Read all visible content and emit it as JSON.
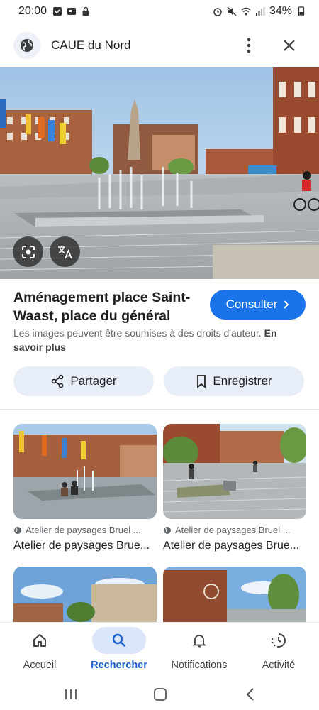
{
  "status_bar": {
    "time": "20:00",
    "battery": "34%"
  },
  "header": {
    "site_name": "CAUE du Nord"
  },
  "result": {
    "title": "Aménagement place Saint-Waast, place du général De...",
    "consult_label": "Consulter",
    "copyright_text": "Les images peuvent être soumises à des droits d'auteur.",
    "learn_more": "En savoir plus"
  },
  "actions": {
    "share_label": "Partager",
    "save_label": "Enregistrer"
  },
  "related": [
    {
      "source": "Atelier de paysages Bruel ...",
      "title": "Atelier de paysages Brue..."
    },
    {
      "source": "Atelier de paysages Bruel ...",
      "title": "Atelier de paysages Brue..."
    }
  ],
  "bottom_nav": [
    {
      "label": "Accueil",
      "icon": "home-icon"
    },
    {
      "label": "Rechercher",
      "icon": "search-icon",
      "active": true
    },
    {
      "label": "Notifications",
      "icon": "bell-icon"
    },
    {
      "label": "Activité",
      "icon": "activity-icon"
    }
  ],
  "colors": {
    "accent": "#1a73e8",
    "chip_bg": "#e8eef8",
    "nav_active_bg": "#dbe6fb"
  }
}
